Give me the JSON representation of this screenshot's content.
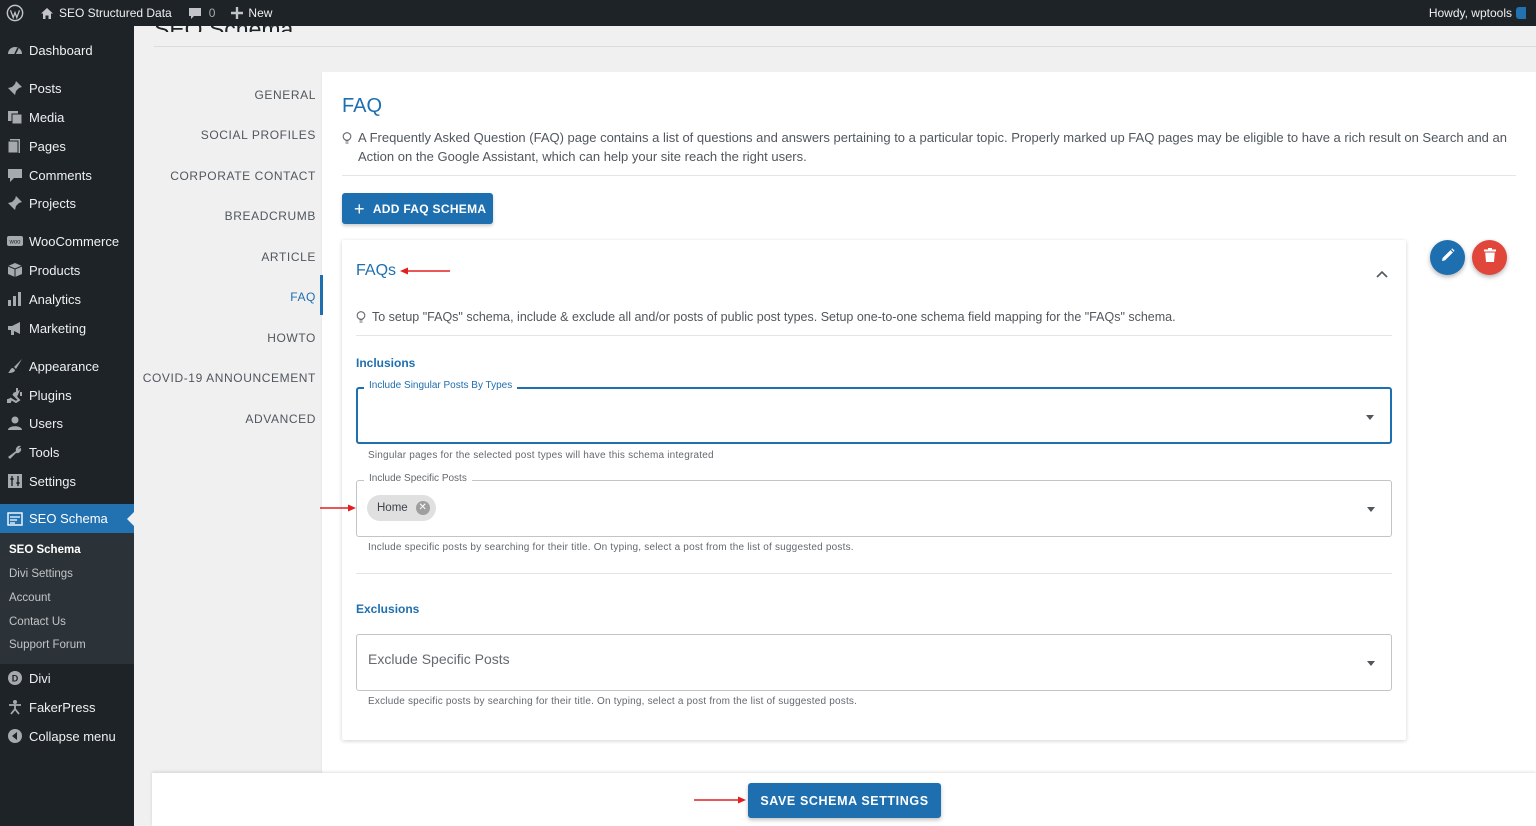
{
  "adminbar": {
    "site_name": "SEO Structured Data",
    "comments_count": "0",
    "new_label": "New",
    "howdy": "Howdy, wptools"
  },
  "sidebar": {
    "items": [
      {
        "label": "Dashboard",
        "icon": "dashboard-icon"
      },
      {
        "label": "Posts",
        "icon": "pin-icon"
      },
      {
        "label": "Media",
        "icon": "media-icon"
      },
      {
        "label": "Pages",
        "icon": "pages-icon"
      },
      {
        "label": "Comments",
        "icon": "comment-icon"
      },
      {
        "label": "Projects",
        "icon": "pin-icon"
      },
      {
        "label": "WooCommerce",
        "icon": "woo-icon"
      },
      {
        "label": "Products",
        "icon": "box-icon"
      },
      {
        "label": "Analytics",
        "icon": "bar-chart-icon"
      },
      {
        "label": "Marketing",
        "icon": "megaphone-icon"
      },
      {
        "label": "Appearance",
        "icon": "brush-icon"
      },
      {
        "label": "Plugins",
        "icon": "plug-icon"
      },
      {
        "label": "Users",
        "icon": "user-icon"
      },
      {
        "label": "Tools",
        "icon": "wrench-icon"
      },
      {
        "label": "Settings",
        "icon": "settings-icon"
      },
      {
        "label": "SEO Schema",
        "icon": "schema-icon"
      },
      {
        "label": "Divi",
        "icon": "divi-icon"
      },
      {
        "label": "FakerPress",
        "icon": "fakerpress-icon"
      },
      {
        "label": "Collapse menu",
        "icon": "collapse-icon"
      }
    ],
    "submenu": [
      "SEO Schema",
      "Divi Settings",
      "Account",
      "Contact Us",
      "Support Forum"
    ]
  },
  "page": {
    "title": "SEO Schema"
  },
  "tabs": [
    "GENERAL",
    "SOCIAL PROFILES",
    "CORPORATE CONTACT",
    "BREADCRUMB",
    "ARTICLE",
    "FAQ",
    "HOWTO",
    "COVID-19 ANNOUNCEMENT",
    "ADVANCED"
  ],
  "active_tab": "FAQ",
  "panel": {
    "title": "FAQ",
    "description": "A Frequently Asked Question (FAQ) page contains a list of questions and answers pertaining to a particular topic. Properly marked up FAQ pages may be eligible to have a rich result on Search and an Action on the Google Assistant, which can help your site reach the right users.",
    "add_button": "ADD FAQ SCHEMA"
  },
  "card": {
    "title": "FAQs",
    "description": "To setup \"FAQs\" schema, include & exclude all and/or posts of public post types. Setup one-to-one schema field mapping for the \"FAQs\" schema.",
    "inclusions_label": "Inclusions",
    "exclusions_label": "Exclusions",
    "singular_field": {
      "label": "Include Singular Posts By Types",
      "value": "",
      "help": "Singular pages for the selected post types will have this schema integrated"
    },
    "specific_field": {
      "label": "Include Specific Posts",
      "chips": [
        "Home"
      ],
      "help": "Include specific posts by searching for their title. On typing, select a post from the list of suggested posts."
    },
    "exclude_field": {
      "placeholder": "Exclude Specific Posts",
      "help": "Exclude specific posts by searching for their title. On typing, select a post from the list of suggested posts."
    }
  },
  "save_button": "SAVE SCHEMA SETTINGS",
  "colors": {
    "accent": "#1e6fb0",
    "danger": "#e0473a",
    "annotation_arrow": "#e02020",
    "admin_dark": "#1d2327"
  }
}
